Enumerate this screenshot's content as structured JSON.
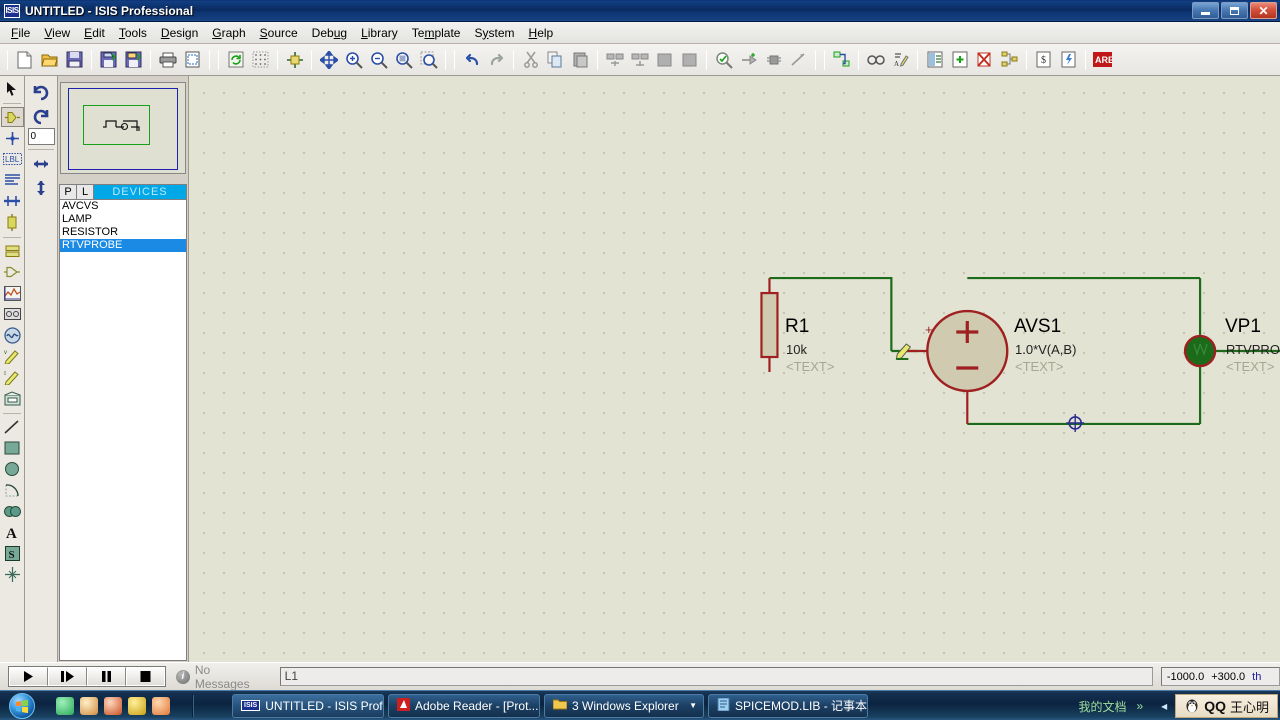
{
  "window": {
    "title": "UNTITLED - ISIS Professional",
    "app_icon": "isis-icon",
    "buttons": {
      "minimize": "minimize",
      "maximize": "maximize",
      "close": "close"
    }
  },
  "menubar": {
    "items": [
      {
        "label": "File",
        "mnemonic": "F"
      },
      {
        "label": "View",
        "mnemonic": "V"
      },
      {
        "label": "Edit",
        "mnemonic": "E"
      },
      {
        "label": "Tools",
        "mnemonic": "T"
      },
      {
        "label": "Design",
        "mnemonic": "D"
      },
      {
        "label": "Graph",
        "mnemonic": "G"
      },
      {
        "label": "Source",
        "mnemonic": "S"
      },
      {
        "label": "Debug",
        "mnemonic": "u"
      },
      {
        "label": "Library",
        "mnemonic": "L"
      },
      {
        "label": "Template",
        "mnemonic": "m"
      },
      {
        "label": "System",
        "mnemonic": "y"
      },
      {
        "label": "Help",
        "mnemonic": "H"
      }
    ]
  },
  "toolbar": {
    "groups": [
      [
        "new-file-icon",
        "open-file-icon",
        "save-file-icon"
      ],
      [
        "import-section-icon",
        "export-section-icon"
      ],
      [
        "print-icon",
        "print-area-icon"
      ],
      [
        "redraw-icon",
        "grid-toggle-icon",
        "origin-icon"
      ],
      [
        "pan-icon",
        "zoom-in-icon",
        "zoom-out-icon",
        "zoom-area-icon",
        "zoom-all-icon"
      ],
      [
        "undo-icon",
        "redo-icon"
      ],
      [
        "cut-icon",
        "copy-icon",
        "paste-icon"
      ],
      [
        "block-copy-icon",
        "block-move-icon",
        "block-rotate-icon",
        "block-delete-icon"
      ],
      [
        "pick-device-icon",
        "make-device-icon",
        "packaging-icon",
        "decompose-icon"
      ],
      [
        "wire-autorouter-icon"
      ],
      [
        "search-tag-icon",
        "property-assignment-icon"
      ],
      [
        "design-explorer-icon",
        "new-sheet-icon",
        "remove-sheet-icon",
        "hierarchy-icon"
      ],
      [
        "bill-of-materials-icon",
        "electrical-rules-check-icon"
      ],
      [
        "ares-netlist-icon"
      ]
    ]
  },
  "modebar": {
    "items": [
      {
        "name": "selection-mode",
        "active": false
      },
      {
        "name": "component-mode",
        "active": true
      },
      {
        "name": "junction-dot-mode",
        "active": false
      },
      {
        "name": "wire-label-mode",
        "active": false
      },
      {
        "name": "text-script-mode",
        "active": false
      },
      {
        "name": "buses-mode",
        "active": false
      },
      {
        "name": "subcircuit-mode",
        "active": false
      },
      {
        "name": "terminals-mode",
        "active": false
      },
      {
        "name": "device-pins-mode",
        "active": false
      },
      {
        "name": "graph-mode",
        "active": false
      },
      {
        "name": "tape-recorder-mode",
        "active": false
      },
      {
        "name": "generator-mode",
        "active": false
      },
      {
        "name": "voltage-probe-mode",
        "active": false
      },
      {
        "name": "current-probe-mode",
        "active": false
      },
      {
        "name": "virtual-instrument-mode",
        "active": false
      },
      {
        "name": "line-tool",
        "active": false
      },
      {
        "name": "box-tool",
        "active": false
      },
      {
        "name": "circle-tool",
        "active": false
      },
      {
        "name": "arc-tool",
        "active": false
      },
      {
        "name": "path-tool",
        "active": false
      },
      {
        "name": "text-tool",
        "active": false
      },
      {
        "name": "symbol-tool",
        "active": false
      },
      {
        "name": "marker-tool",
        "active": false
      }
    ]
  },
  "rotationbar": {
    "rotate_cw": "rotate-clockwise-icon",
    "rotate_ccw": "rotate-counterclockwise-icon",
    "angle_value": "0",
    "mirror_x": "mirror-horizontal-icon",
    "mirror_y": "mirror-vertical-icon"
  },
  "devices_panel": {
    "col_p": "P",
    "col_l": "L",
    "title": "DEVICES",
    "items": [
      {
        "label": "AVCVS",
        "selected": false
      },
      {
        "label": "LAMP",
        "selected": false
      },
      {
        "label": "RESISTOR",
        "selected": false
      },
      {
        "label": "RTVPROBE",
        "selected": true
      }
    ]
  },
  "schematic": {
    "components": [
      {
        "name": "R1",
        "value": "10k",
        "text": "<TEXT>",
        "type": "resistor"
      },
      {
        "name": "AVS1",
        "value": "1.0*V(A,B)",
        "text": "<TEXT>",
        "type": "arbitrary-voltage-source",
        "plus_marker": "+",
        "symbol_plus": "+",
        "symbol_minus": "−"
      },
      {
        "name": "VP1",
        "value": "RTVPROBE",
        "text": "<TEXT>",
        "type": "realtime-voltage-probe"
      }
    ],
    "annotations": {
      "pin_plus_label": "+",
      "pencil_cursor": "pencil-cursor-icon",
      "junction_marker": "junction-crosshair-icon"
    },
    "colors": {
      "wire": "#1b6b1b",
      "body": "#9e2020",
      "background": "#e3e3d3",
      "fill": "#cfcab0"
    }
  },
  "statusbar": {
    "animation_controls": [
      {
        "name": "play-button",
        "glyph": "▶"
      },
      {
        "name": "step-button",
        "glyph": "step"
      },
      {
        "name": "pause-button",
        "glyph": "‖"
      },
      {
        "name": "stop-button",
        "glyph": "■"
      }
    ],
    "message_icon": "info-icon",
    "message": "No Messages",
    "field_value": "L1",
    "coordinates": {
      "x": "-1000.0",
      "y": "+300.0",
      "units": "th"
    }
  },
  "taskbar": {
    "start_button": "start-orb-icon",
    "quick_launch": [
      {
        "name": "messenger-icon",
        "color": "#3fbf6f"
      },
      {
        "name": "media-icon",
        "color": "#e8d8a0"
      },
      {
        "name": "penguin-icon",
        "color": "#e07040"
      },
      {
        "name": "browser-icon",
        "color": "#d8c020"
      },
      {
        "name": "photo-icon",
        "color": "#e08840"
      }
    ],
    "tasks": [
      {
        "label": "UNTITLED - ISIS Profe...",
        "icon": "isis-icon",
        "active": true,
        "has_arrow": false
      },
      {
        "label": "Adobe Reader - [Prot...",
        "icon": "adobe-icon",
        "active": false,
        "has_arrow": false
      },
      {
        "label": "3 Windows Explorer",
        "icon": "folder-icon",
        "active": false,
        "has_arrow": true
      },
      {
        "label": "SPICEMOD.LIB - 记事本",
        "icon": "notepad-icon",
        "active": false,
        "has_arrow": false
      }
    ],
    "tray": {
      "documents_label": "我的文档",
      "chevron": "»",
      "collapse": "◂",
      "qq_label": "王心明",
      "qq_brand": "QQ"
    }
  }
}
